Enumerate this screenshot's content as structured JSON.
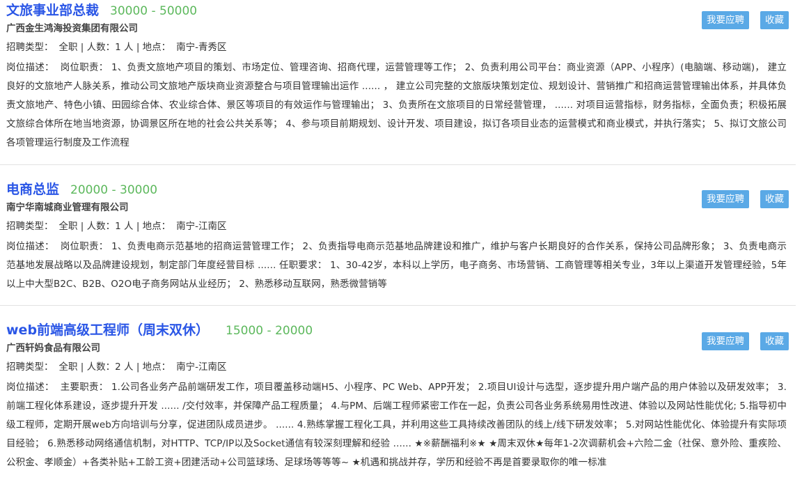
{
  "labels": {
    "type": "招聘类型：",
    "count": "人数：",
    "location": "地点：",
    "desc": "岗位描述："
  },
  "buttons": {
    "apply": "我要应聘",
    "favorite": "收藏"
  },
  "jobs": [
    {
      "title": "文旅事业部总裁",
      "salary": "30000 - 50000",
      "company": "广西金生鸿海投资集团有限公司",
      "type": "全职",
      "count": "1 人",
      "location": "南宁-青秀区",
      "description": "岗位职责： 1、负责文旅地产项目的策划、市场定位、管理咨询、招商代理，运营管理等工作； 2、负责利用公司平台：商业资源（APP、小程序）(电脑端、移动端)， 建立良好的文旅地产人脉关系，推动公司文旅地产版块商业资源整合与项目管理输出运作 ...... ， 建立公司完整的文旅版块策划定位、规划设计、营销推广和招商运营管理输出体系，并具体负责文旅地产、特色小镇、田园综合体、农业综合体、景区等项目的有效运作与管理输出； 3、负责所在文旅项目的日常经营管理， ...... 对项目运营指标，财务指标，全面负责；积极拓展文旅综合体所在地当地资源，协调景区所在地的社会公共关系等； 4、参与项目前期规划、设计开发、项目建设，拟订各项目业态的运营模式和商业模式，并执行落实； 5、拟订文旅公司各项管理运行制度及工作流程"
    },
    {
      "title": "电商总监",
      "salary": "20000 - 30000",
      "company": "南宁华南城商业管理有限公司",
      "type": "全职",
      "count": "1 人",
      "location": "南宁-江南区",
      "description": "岗位职责： 1、负责电商示范基地的招商运营管理工作； 2、负责指导电商示范基地品牌建设和推广，维护与客户长期良好的合作关系，保持公司品牌形象； 3、负责电商示范基地发展战略以及品牌建设规划，制定部门年度经营目标 ...... 任职要求： 1、30-42岁，本科以上学历，电子商务、市场营销、工商管理等相关专业，3年以上渠道开发管理经验，5年以上中大型B2C、B2B、O2O电子商务网站从业经历； 2、熟悉移动互联网，熟悉微营销等"
    },
    {
      "title": "web前端高级工程师（周末双休）",
      "salary": "15000 - 20000",
      "company": "广西轩妈食品有限公司",
      "type": "全职",
      "count": "2 人",
      "location": "南宁-江南区",
      "description": "主要职责： 1.公司各业务产品前端研发工作，项目覆盖移动端H5、小程序、PC Web、APP开发； 2.项目UI设计与选型，逐步提升用户端产品的用户体验以及研发效率； 3.前端工程化体系建设，逐步提升开发 ...... /交付效率，并保障产品工程质量； 4.与PM、后端工程师紧密工作在一起，负责公司各业务系统易用性改进、体验以及网站性能优化; 5.指导初中级工程师，定期开展web方向培训与分享，促进团队成员进步。 ...... 4.熟练掌握工程化工具，并利用这些工具持续改善团队的线上/线下研发效率； 5.对网站性能优化、体验提升有实际项目经验； 6.熟悉移动网络通信机制，对HTTP、TCP/IP以及Socket通信有较深刻理解和经验 ...... ★※薪酬福利※★ ★周末双休★每年1-2次调薪机会+六险二金（社保、意外险、重疾险、公积金、孝顺金）+各类补贴+工龄工资+团建活动+公司篮球场、足球场等等等~ ★机遇和挑战并存，学历和经验不再是首要录取你的唯一标准"
    }
  ]
}
